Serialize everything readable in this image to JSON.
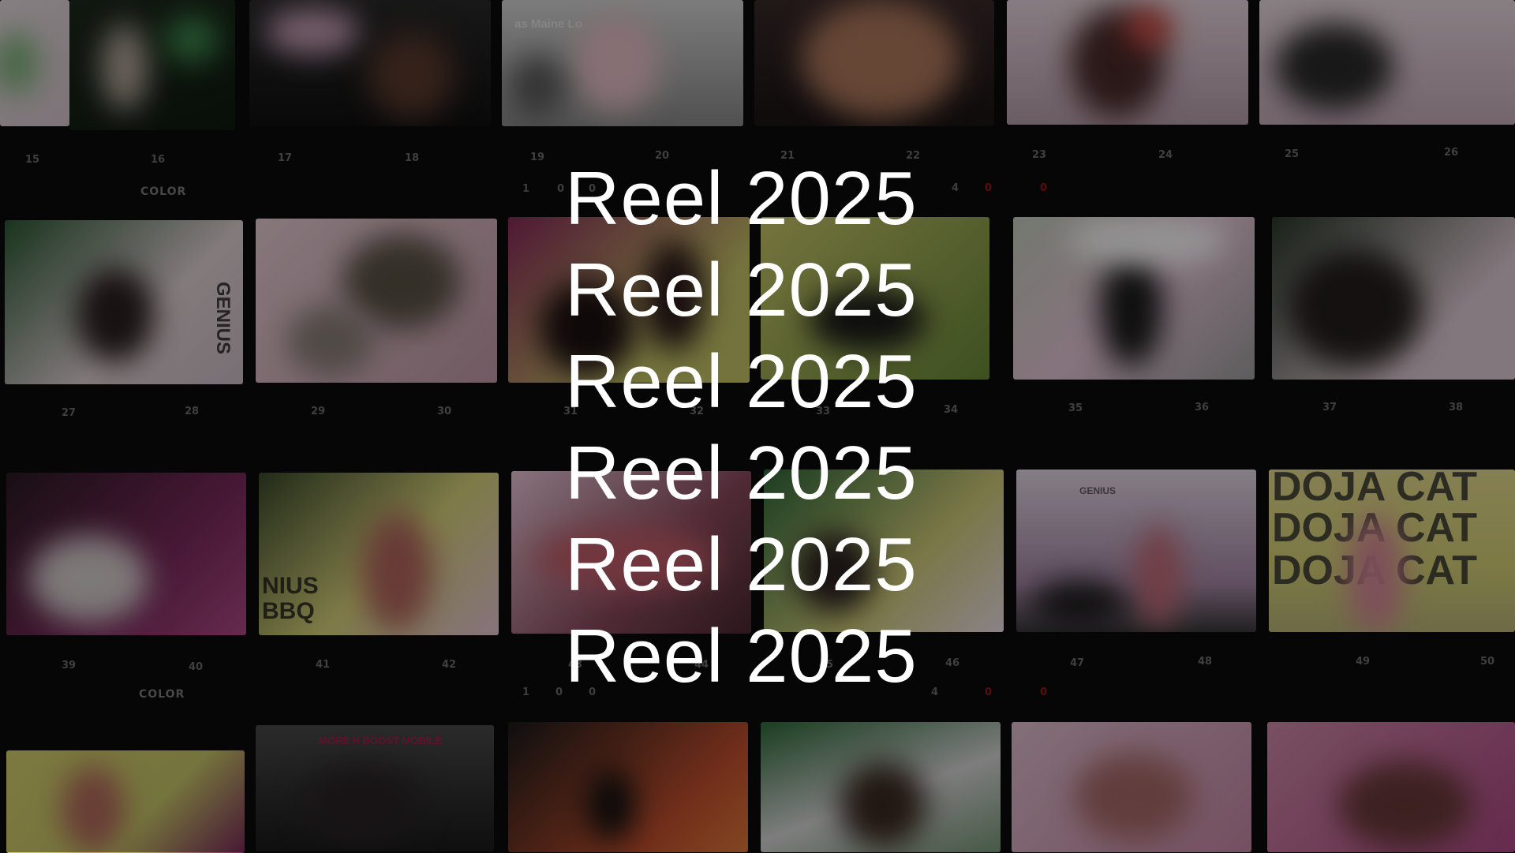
{
  "title_lines": [
    "Reel 2025",
    "Reel 2025",
    "Reel 2025",
    "Reel 2025",
    "Reel 2025",
    "Reel 2025"
  ],
  "edge_labels": [
    "COLOR",
    "COLOR"
  ],
  "edge_codes": {
    "row1": [
      "1",
      "0",
      "0",
      "4",
      "0",
      "0"
    ],
    "row3": [
      "1",
      "0",
      "0",
      "4",
      "0",
      "0"
    ]
  },
  "frame_numbers": {
    "row1": [
      "15",
      "16",
      "17",
      "18",
      "19",
      "20",
      "21",
      "22",
      "23",
      "24",
      "25",
      "26"
    ],
    "row2": [
      "27",
      "28",
      "29",
      "30",
      "31",
      "32",
      "33",
      "34",
      "35",
      "36",
      "37",
      "38"
    ],
    "row3": [
      "39",
      "40",
      "41",
      "42",
      "43",
      "44",
      "45",
      "46",
      "47",
      "48",
      "49",
      "50"
    ]
  },
  "frame_texts": {
    "doja": [
      "DOJA CAT",
      "DOJA CAT",
      "DOJA CAT"
    ],
    "bbq": "NIUS\nBBQ",
    "boost": "MORE   H BOOST MOBILE",
    "genius_banner": "GENIUS",
    "maine": "as Maine Lo"
  },
  "colors": {
    "title": "#ffffff",
    "film_base": "#0b0b0b",
    "pink": "#c44a8f",
    "magenta": "#8a2a6a",
    "yellow_green": "#c9c86a",
    "green_stage": "#2f6b3a",
    "skin": "#b07a5e",
    "edge_red": "#9a1a1a"
  }
}
